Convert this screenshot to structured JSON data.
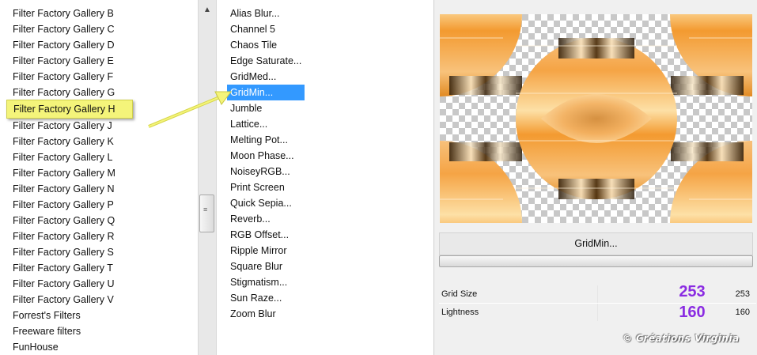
{
  "categories": [
    "Filter Factory Gallery B",
    "Filter Factory Gallery C",
    "Filter Factory Gallery D",
    "Filter Factory Gallery E",
    "Filter Factory Gallery F",
    "Filter Factory Gallery G",
    "Filter Factory Gallery H",
    "Filter Factory Gallery J",
    "Filter Factory Gallery K",
    "Filter Factory Gallery L",
    "Filter Factory Gallery M",
    "Filter Factory Gallery N",
    "Filter Factory Gallery P",
    "Filter Factory Gallery Q",
    "Filter Factory Gallery R",
    "Filter Factory Gallery S",
    "Filter Factory Gallery T",
    "Filter Factory Gallery U",
    "Filter Factory Gallery V",
    "Forrest's Filters",
    "Freeware filters",
    "FunHouse"
  ],
  "highlighted_category_index": 6,
  "filters": [
    "Alias Blur...",
    "Channel 5",
    "Chaos Tile",
    "Edge Saturate...",
    "GridMed...",
    "GridMin...",
    "Jumble",
    "Lattice...",
    "Melting Pot...",
    "Moon Phase...",
    "NoiseyRGB...",
    "Print Screen",
    "Quick Sepia...",
    "Reverb...",
    "RGB Offset...",
    "Ripple Mirror",
    "Square Blur",
    "Stigmatism...",
    "Sun Raze...",
    "Zoom Blur"
  ],
  "selected_filter_index": 5,
  "panel": {
    "filter_name": "GridMin...",
    "params": [
      {
        "name": "Grid Size",
        "value": "253",
        "annotation": "253"
      },
      {
        "name": "Lightness",
        "value": "160",
        "annotation": "160"
      }
    ]
  },
  "watermark": "© Créations Virginia",
  "colors": {
    "selection": "#3399ff",
    "highlight": "#f4f47a",
    "annotation": "#8a2be2",
    "arrow": "#e8e860"
  },
  "icons": {
    "scroll_up": "triangle-up-icon",
    "thumb_grip": "grip-icon",
    "pointer": "arrow-icon"
  }
}
